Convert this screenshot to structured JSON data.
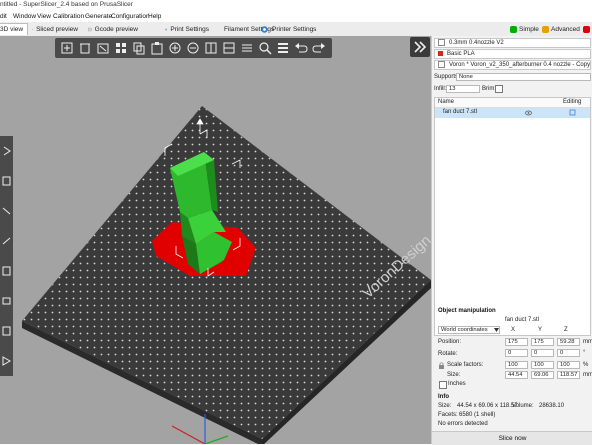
{
  "window": {
    "title": "ntitled - SuperSlicer_2.4 based on PrusaSlicer"
  },
  "menu": [
    "dit",
    "Window",
    "View",
    "Calibration",
    "Generate",
    "Configuration",
    "Help"
  ],
  "tabs": [
    {
      "label": "3D view",
      "icon": "cube-icon"
    },
    {
      "label": "Sliced preview",
      "icon": "layers-icon"
    },
    {
      "label": "Gcode preview",
      "icon": "gcode-icon"
    },
    {
      "label": "Print Settings",
      "icon": "gear-icon"
    },
    {
      "label": "Filament Settings",
      "icon": "spool-icon"
    },
    {
      "label": "Printer Settings",
      "icon": "printer-icon"
    }
  ],
  "modes": [
    {
      "label": "Simple",
      "color": "#00b000"
    },
    {
      "label": "Advanced",
      "color": "#e8a000"
    },
    {
      "label": "",
      "color": "#e00000"
    }
  ],
  "toolbar_icons": [
    "add-icon",
    "delete-icon",
    "delete-all-icon",
    "arrange-icon",
    "copy-icon",
    "paste-icon",
    "add-instance-icon",
    "remove-instance-icon",
    "split-objects-icon",
    "split-parts-icon",
    "layer-editing-icon",
    "search-icon",
    "layers-icon",
    "undo-icon",
    "redo-icon"
  ],
  "left_toolbar_icons": [
    "move-icon",
    "scale-icon",
    "rotate-icon",
    "place-on-face-icon",
    "cut-icon",
    "supports-paint-icon",
    "seam-paint-icon",
    "hollow-icon"
  ],
  "bed": {
    "logo_text": "VoronDesign"
  },
  "presets": {
    "print": "0.3mm 0.4nozzle V2",
    "filament": "Basic PLA",
    "printer": "Voron * Voron_v2_350_afterburner 0.4 nozzle - Copy",
    "filament_color": "#e02020",
    "print_color": "#ffffff"
  },
  "supports": {
    "label": "Supports:",
    "value": "None"
  },
  "infill": {
    "label": "Infill:",
    "value": "13",
    "brim_label": "Brim:"
  },
  "object_list": {
    "columns": [
      "Name",
      "Editing"
    ],
    "rows": [
      {
        "name": "fan duct 7.stl"
      }
    ]
  },
  "manipulation": {
    "title": "Object manipulation",
    "object_name": "fan duct 7.stl",
    "coord_system": "World coordinates",
    "axes": [
      "X",
      "Y",
      "Z"
    ],
    "position": {
      "label": "Position:",
      "values": [
        "175",
        "175",
        "59.28"
      ],
      "unit": "mm"
    },
    "rotate": {
      "label": "Rotate:",
      "values": [
        "0",
        "0",
        "0"
      ],
      "unit": "°"
    },
    "scale": {
      "label": "Scale factors:",
      "values": [
        "100",
        "100",
        "100"
      ],
      "unit": "%"
    },
    "size": {
      "label": "Size:",
      "values": [
        "44.54",
        "69.06",
        "118.57"
      ],
      "unit": "mm"
    },
    "inches_label": "Inches"
  },
  "info": {
    "title": "Info",
    "size_label": "Size:",
    "size_value": "44.54 x 69.06 x 118.57",
    "volume_label": "Volume:",
    "volume_value": "28638.10",
    "facets_label": "Facets:",
    "facets_value": "6580 (1 shell)",
    "errors": "No errors detected"
  },
  "slice_button": "Slice now"
}
